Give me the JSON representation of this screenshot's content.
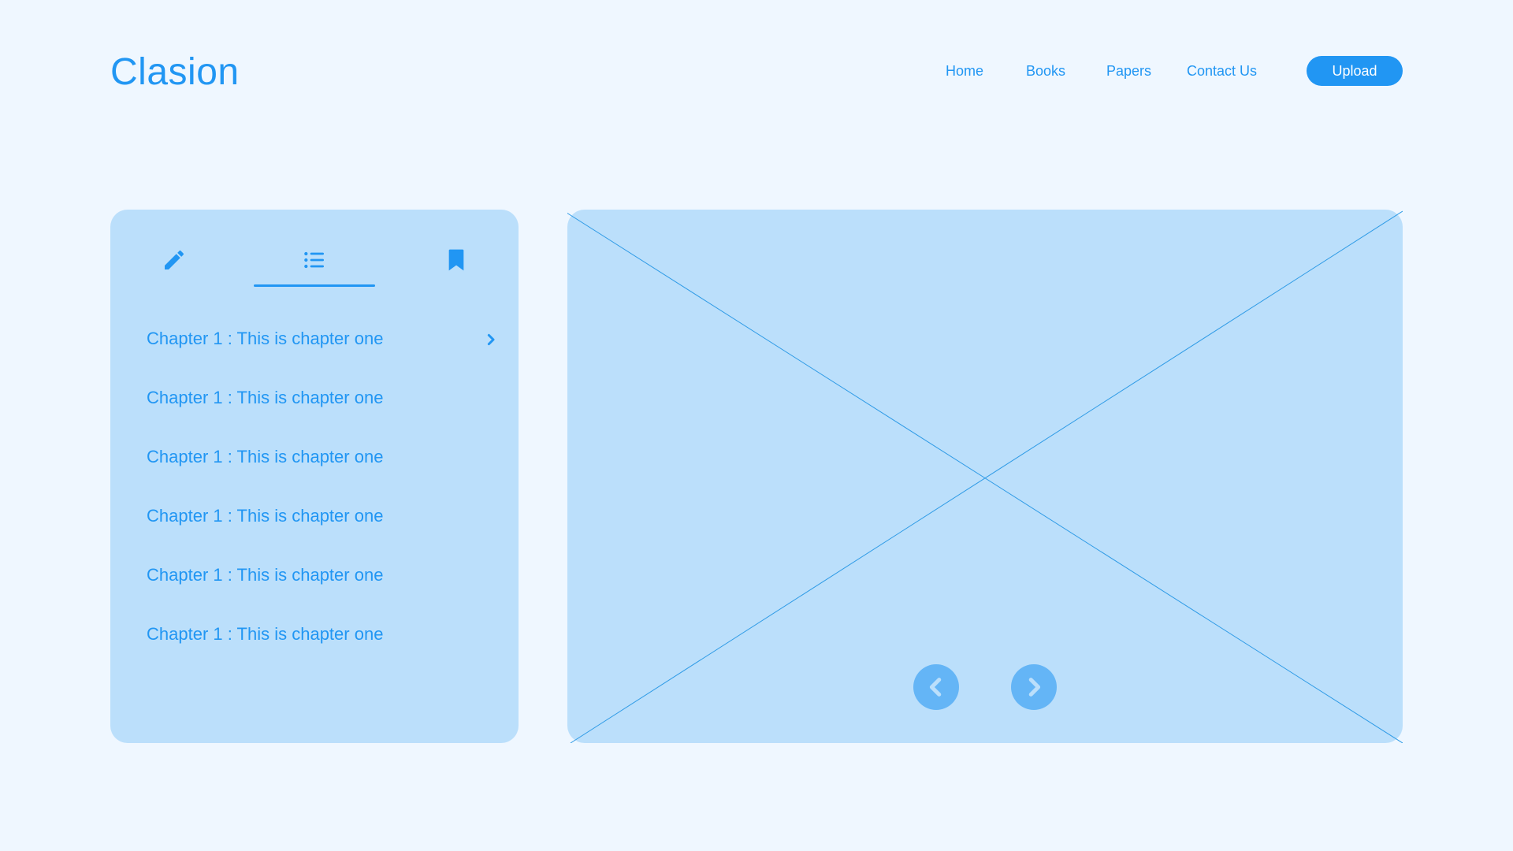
{
  "app": {
    "logo": "Clasion"
  },
  "nav": {
    "links": [
      {
        "label": "Home"
      },
      {
        "label": "Books"
      },
      {
        "label": "Papers"
      },
      {
        "label": "Contact Us"
      }
    ],
    "upload_label": "Upload"
  },
  "sidebar": {
    "tabs": [
      {
        "icon": "pencil-icon"
      },
      {
        "icon": "list-icon",
        "active": true
      },
      {
        "icon": "bookmark-icon"
      }
    ],
    "chapters": [
      {
        "label": "Chapter 1 : This is chapter one"
      },
      {
        "label": "Chapter 1 : This is chapter one"
      },
      {
        "label": "Chapter 1 : This is chapter one"
      },
      {
        "label": "Chapter 1 : This is chapter one"
      },
      {
        "label": "Chapter 1 : This is chapter one"
      },
      {
        "label": "Chapter 1 : This is chapter one"
      }
    ]
  },
  "viewer": {
    "prev_icon": "chevron-left-icon",
    "next_icon": "chevron-right-icon"
  },
  "colors": {
    "background": "#eff7ff",
    "accent": "#2196f3",
    "card": "#bbdffb",
    "arrow_button": "#64b5f6"
  }
}
